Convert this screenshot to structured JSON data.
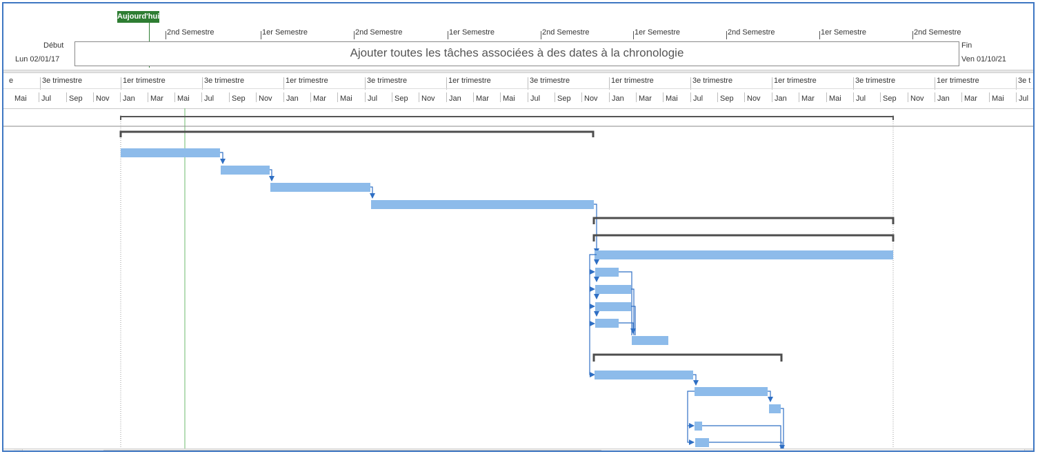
{
  "timeline": {
    "today_label": "Aujourd'hui",
    "start_label": "Début",
    "start_date": "Lun 02/01/17",
    "end_label": "Fin",
    "end_date": "Ven 01/10/21",
    "placeholder": "Ajouter toutes les tâches associées à des dates à la chronologie",
    "semesters": [
      "2nd Semestre",
      "1er Semestre",
      "2nd Semestre",
      "1er Semestre",
      "2nd Semestre",
      "1er Semestre",
      "2nd Semestre",
      "1er Semestre",
      "2nd Semestre"
    ]
  },
  "header": {
    "quarters": [
      "e",
      "3e trimestre",
      "1er trimestre",
      "3e trimestre",
      "1er trimestre",
      "3e trimestre",
      "1er trimestre",
      "3e trimestre",
      "1er trimestre",
      "3e trimestre",
      "1er trimestre",
      "3e trimestre",
      "1er trimestre",
      "3e t"
    ],
    "months": [
      "Mai",
      "Jul",
      "Sep",
      "Nov",
      "Jan",
      "Mar",
      "Mai",
      "Jul",
      "Sep",
      "Nov",
      "Jan",
      "Mar",
      "Mai",
      "Jul",
      "Sep",
      "Nov",
      "Jan",
      "Mar",
      "Mai",
      "Jul",
      "Sep",
      "Nov",
      "Jan",
      "Mar",
      "Mai",
      "Jul",
      "Sep",
      "Nov",
      "Jan",
      "Mar",
      "Mai",
      "Jul",
      "Sep",
      "Nov",
      "Jan",
      "Mar",
      "Mai",
      "Jul",
      "Sep",
      "Nov",
      "Jan",
      "Mar",
      "Mai",
      "Ju"
    ]
  },
  "colors": {
    "task_bar": "#8dbbea",
    "link": "#2f6fc4",
    "summary": "#4d4d4d",
    "today": "#2e7d32",
    "frame": "#3d76c2"
  }
}
